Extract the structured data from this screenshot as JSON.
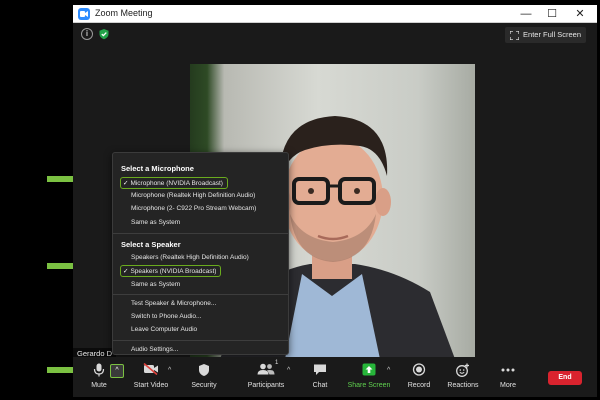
{
  "window": {
    "title": "Zoom Meeting",
    "controls": {
      "minimize": "—",
      "maximize": "☐",
      "close": "✕"
    }
  },
  "topbar": {
    "info_icon": "info-icon",
    "security_icon": "shield-check-icon",
    "fullscreen_label": "Enter Full Screen"
  },
  "participant": {
    "name": "Gerardo D"
  },
  "audio_menu": {
    "microphone_heading": "Select a Microphone",
    "microphones": [
      {
        "label": "Microphone (NVIDIA Broadcast)",
        "selected": true
      },
      {
        "label": "Microphone (Realtek High Definition Audio)",
        "selected": false
      },
      {
        "label": "Microphone (2- C922 Pro Stream Webcam)",
        "selected": false
      },
      {
        "label": "Same as System",
        "selected": false
      }
    ],
    "speaker_heading": "Select a Speaker",
    "speakers": [
      {
        "label": "Speakers (Realtek High Definition Audio)",
        "selected": false
      },
      {
        "label": "Speakers (NVIDIA Broadcast)",
        "selected": true
      },
      {
        "label": "Same as System",
        "selected": false
      }
    ],
    "actions": [
      "Test Speaker & Microphone...",
      "Switch to Phone Audio...",
      "Leave Computer Audio"
    ],
    "settings": "Audio Settings...",
    "check_glyph": "✓"
  },
  "toolbar": {
    "mute": "Mute",
    "start_video": "Start Video",
    "security": "Security",
    "participants": "Participants",
    "participants_count": "1",
    "chat": "Chat",
    "share_screen": "Share Screen",
    "record": "Record",
    "reactions": "Reactions",
    "more": "More",
    "end": "End",
    "caret_glyph": "^"
  },
  "colors": {
    "accent_green": "#6aab1e",
    "arrow_green": "#7bc142",
    "share_green": "#5fd14f",
    "end_red": "#d9232e",
    "zoom_blue": "#2d8cff"
  }
}
